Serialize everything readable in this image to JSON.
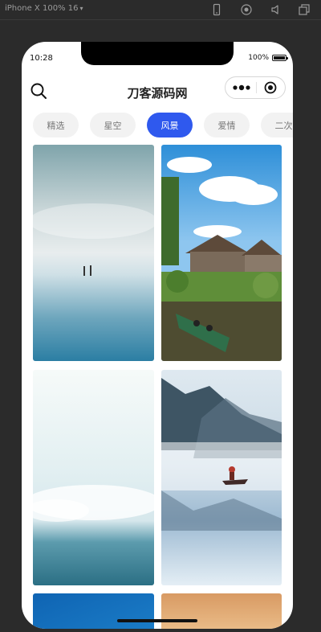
{
  "devtools": {
    "device": "iPhone X 100% 16",
    "icons": [
      "phone-icon",
      "record-icon",
      "mute-icon",
      "window-icon"
    ]
  },
  "status_bar": {
    "time": "10:28",
    "battery": "100%"
  },
  "header": {
    "title": "刀客源码网",
    "icons": [
      "search-icon",
      "more-dots-icon",
      "close-target-icon"
    ]
  },
  "tabs": [
    {
      "label": "精选",
      "active": false
    },
    {
      "label": "星空",
      "active": false
    },
    {
      "label": "风景",
      "active": true
    },
    {
      "label": "爱情",
      "active": false
    },
    {
      "label": "二次",
      "active": false
    }
  ],
  "colors": {
    "accent": "#2f59ee",
    "tab_bg": "#f2f2f2",
    "tab_text": "#777777"
  },
  "wallpapers": [
    {
      "name": "misty-beach-people"
    },
    {
      "name": "village-canal-boat"
    },
    {
      "name": "sky-over-sea"
    },
    {
      "name": "foggy-lake-boatman"
    },
    {
      "name": "blue-sky"
    },
    {
      "name": "sunset-sky"
    }
  ]
}
